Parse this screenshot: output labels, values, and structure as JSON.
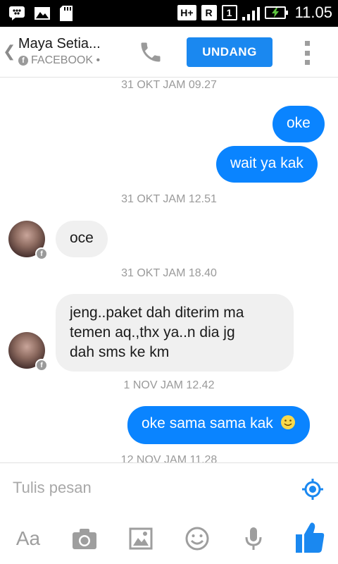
{
  "status_bar": {
    "network": "H+",
    "roaming": "R",
    "sim": "1",
    "time": "11.05"
  },
  "header": {
    "contact_name": "Maya Setia...",
    "source": "FACEBOOK •",
    "invite_label": "UNDANG"
  },
  "messages": [
    {
      "type": "timestamp",
      "text": "31 OKT JAM 09.27"
    },
    {
      "type": "outgoing",
      "text": "oke"
    },
    {
      "type": "outgoing",
      "text": "wait ya kak"
    },
    {
      "type": "timestamp",
      "text": "31 OKT JAM 12.51"
    },
    {
      "type": "incoming",
      "text": "oce"
    },
    {
      "type": "timestamp",
      "text": "31 OKT JAM 18.40"
    },
    {
      "type": "incoming",
      "lines": [
        "jeng..paket dah diterim ma",
        "temen aq.,thx ya..n dia jg",
        "dah sms ke km"
      ]
    },
    {
      "type": "timestamp",
      "text": "1 NOV JAM 12.42"
    },
    {
      "type": "outgoing",
      "text": "oke sama sama kak",
      "emoji": "smiley-icon"
    },
    {
      "type": "timestamp",
      "text": "12 NOV JAM 11.28"
    }
  ],
  "composer": {
    "placeholder": "Tulis pesan"
  },
  "toolbar": {
    "text_style_label": "Aa",
    "icons": [
      "camera-icon",
      "gallery-icon",
      "emoji-icon",
      "microphone-icon",
      "like-icon"
    ]
  },
  "colors": {
    "accent": "#1a88f0",
    "outgoing_bubble": "#0a84ff",
    "incoming_bubble": "#f0f0f0",
    "timestamp": "#9a9a9a"
  }
}
